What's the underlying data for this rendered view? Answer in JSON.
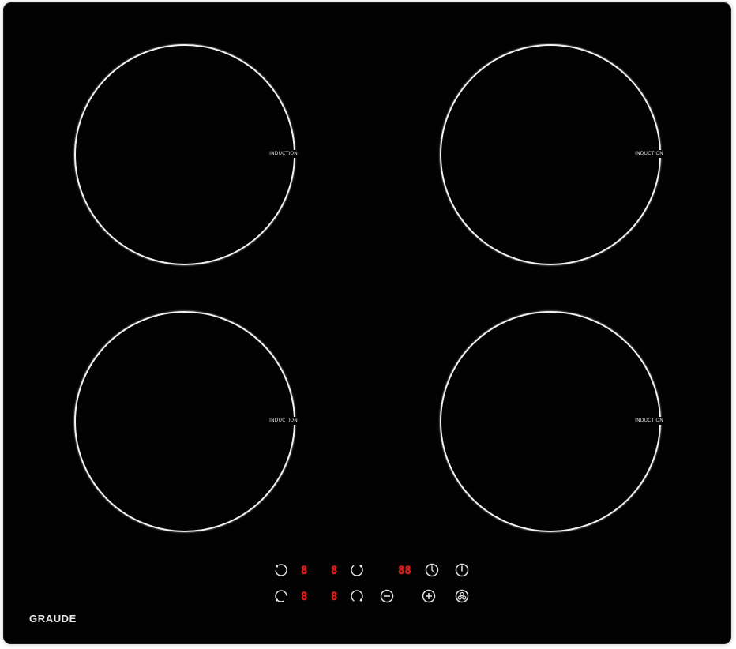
{
  "cooktop": {
    "colors": {
      "glass": "#020202",
      "zone_ring": "#f2f2f2",
      "display": "#e32020",
      "icon": "#e0e0e0"
    },
    "zones": [
      {
        "id": "front-left",
        "label": "INDUCTION"
      },
      {
        "id": "rear-right",
        "label": "INDUCTION"
      },
      {
        "id": "rear-left",
        "label": "INDUCTION"
      },
      {
        "id": "front-right",
        "label": "INDUCTION"
      }
    ],
    "controls": {
      "row1_display_left": "8",
      "row1_display_right": "8",
      "timer_display": "88",
      "row2_display_left": "8",
      "row2_display_right": "8"
    },
    "icons": {
      "zone_select_1": "zone-select-icon",
      "zone_select_2": "zone-select-icon",
      "zone_select_3": "zone-select-icon",
      "zone_select_4": "zone-select-icon",
      "timer": "clock-icon",
      "power": "power-icon",
      "minus": "minus-icon",
      "plus": "plus-icon",
      "lock": "child-lock-icon"
    },
    "brand": "GRAUDE"
  }
}
